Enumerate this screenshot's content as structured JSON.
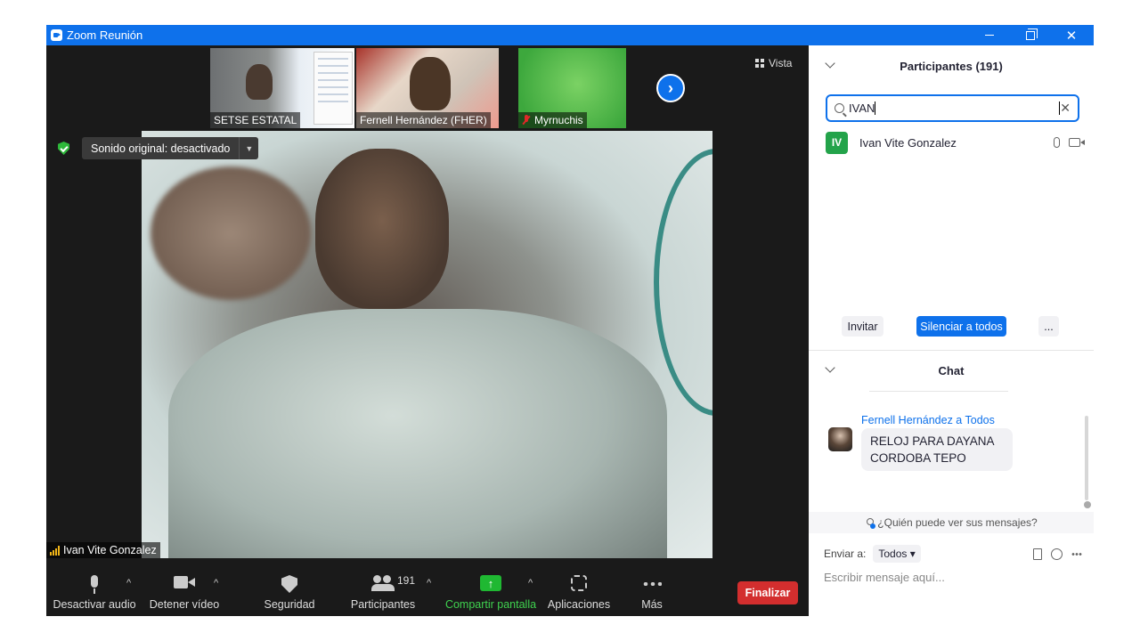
{
  "window": {
    "title": "Zoom Reunión"
  },
  "thumbnails": [
    {
      "name": "SETSE ESTATAL",
      "muted": false
    },
    {
      "name": "Fernell Hernández (FHER)",
      "muted": false
    },
    {
      "name": "Myrnuchis",
      "muted": true
    }
  ],
  "view_button": "Vista",
  "sound_notice": "Sonido original: desactivado",
  "main_speaker": "Ivan Vite Gonzalez",
  "toolbar": {
    "mute_label": "Desactivar audio",
    "video_label": "Detener vídeo",
    "security_label": "Seguridad",
    "participants_label": "Participantes",
    "participants_count": "191",
    "share_label": "Compartir pantalla",
    "apps_label": "Aplicaciones",
    "more_label": "Más",
    "end_label": "Finalizar"
  },
  "participants_panel": {
    "title": "Participantes (191)",
    "search_value": "IVAN",
    "results": [
      {
        "initials": "IV",
        "name": "Ivan Vite Gonzalez"
      }
    ],
    "invite_label": "Invitar",
    "mute_all_label": "Silenciar a todos",
    "more_label": "..."
  },
  "chat": {
    "title": "Chat",
    "messages": [
      {
        "sender": "Fernell Hernández a Todos",
        "text": "RELOJ PARA  DAYANA CORDOBA TEPO"
      }
    ],
    "who_sees": "¿Quién puede ver sus mensajes?",
    "send_to_label": "Enviar a:",
    "send_to_value": "Todos",
    "input_placeholder": "Escribir mensaje aquí..."
  },
  "colors": {
    "titlebar": "#0e71eb",
    "accent": "#0e71eb",
    "end_button": "#d32e2e",
    "share_green": "#1fb832",
    "avatar_green": "#23a34a"
  }
}
